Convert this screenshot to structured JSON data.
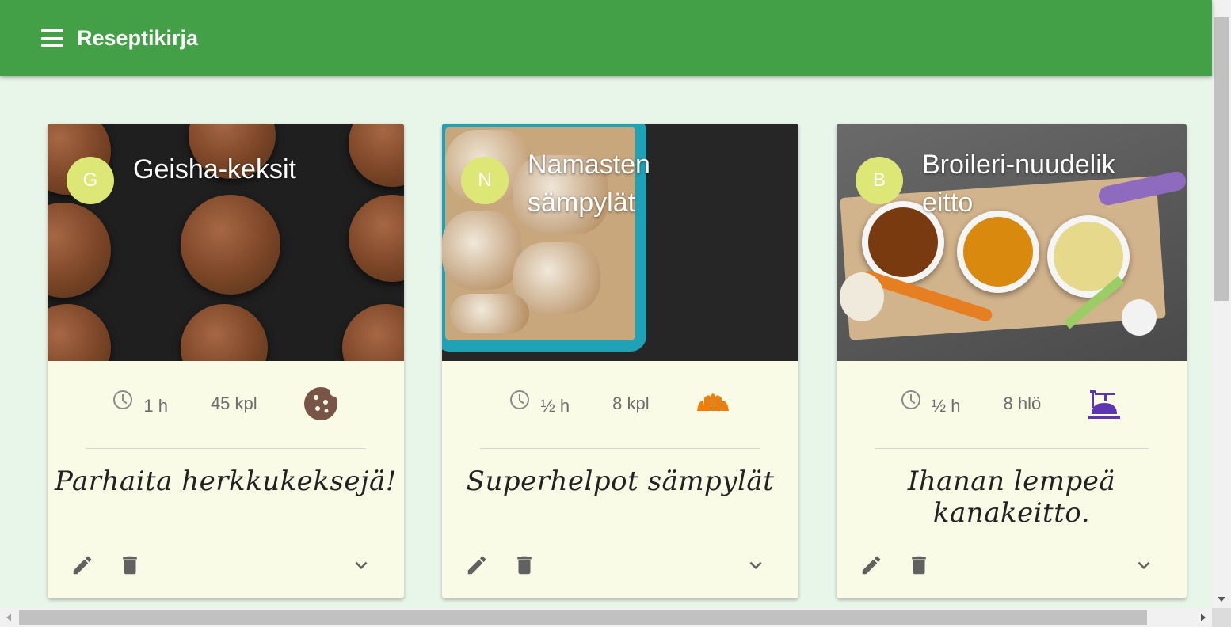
{
  "app": {
    "title": "Reseptikirja",
    "menu_icon": "menu-icon"
  },
  "colors": {
    "appbar": "#43a047",
    "background": "#e8f5e9",
    "card": "#f9fbe7",
    "avatar": "#dce775",
    "cookie_icon": "#795548",
    "croissant_icon": "#f57c00",
    "pot_icon": "#5e35b1",
    "muted_icon": "#616161"
  },
  "recipes": [
    {
      "avatar": "G",
      "title": "Geisha-keksit",
      "time": "1 h",
      "amount": "45 kpl",
      "category_icon": "cookie-icon",
      "description": "Parhaita herkkukeksejä!"
    },
    {
      "avatar": "N",
      "title": "Namasten sämpylät",
      "time": "½ h",
      "amount": "8 kpl",
      "category_icon": "croissant-icon",
      "description": "Superhelpot sämpylät"
    },
    {
      "avatar": "B",
      "title": "Broileri-nuudelikeitto",
      "time": "½ h",
      "amount": "8 hlö",
      "category_icon": "soup-pot-icon",
      "description": "Ihanan lempeä kanakeitto."
    }
  ]
}
